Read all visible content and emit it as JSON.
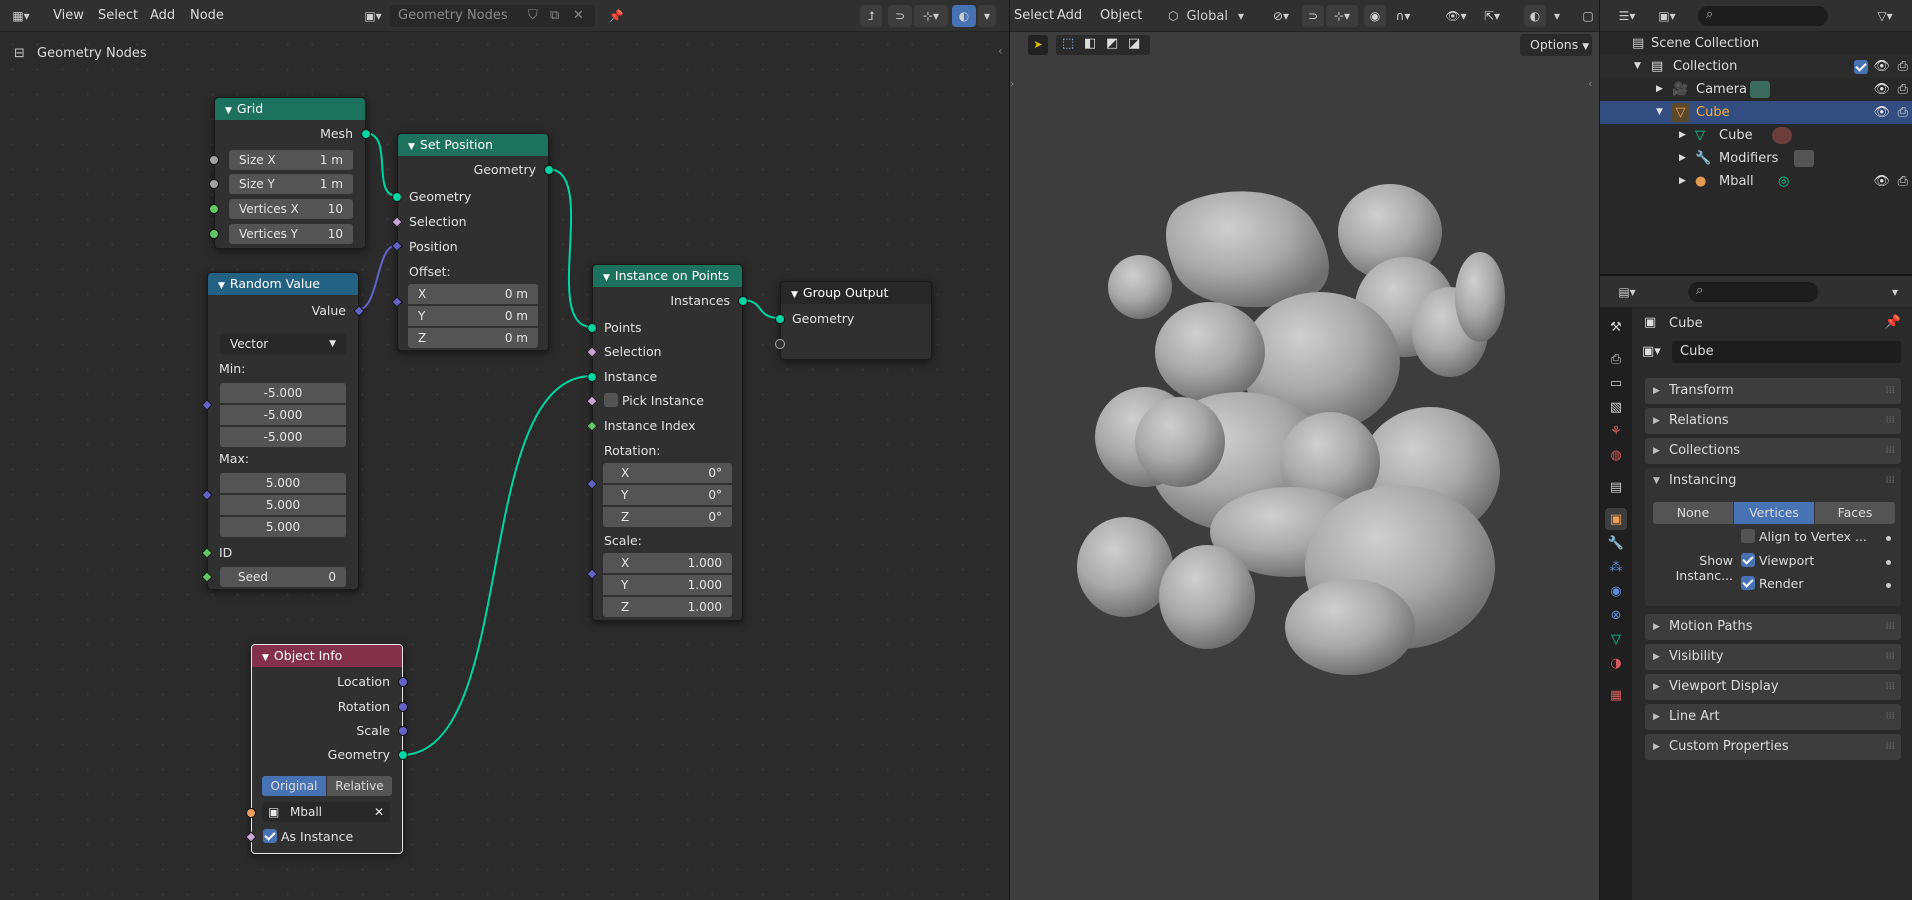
{
  "node_editor": {
    "menu": {
      "view": "View",
      "select": "Select",
      "add": "Add",
      "node": "Node"
    },
    "tree_name": "Geometry Nodes",
    "breadcrumb": "Geometry Nodes",
    "nodes": {
      "grid": {
        "title": "Grid",
        "out_mesh": "Mesh",
        "size_x_label": "Size X",
        "size_x": "1 m",
        "size_y_label": "Size Y",
        "size_y": "1 m",
        "vx_label": "Vertices X",
        "vx": "10",
        "vy_label": "Vertices Y",
        "vy": "10"
      },
      "set_position": {
        "title": "Set Position",
        "out_geometry": "Geometry",
        "in_geometry": "Geometry",
        "selection": "Selection",
        "position": "Position",
        "offset": "Offset:",
        "x_label": "X",
        "x": "0 m",
        "y_label": "Y",
        "y": "0 m",
        "z_label": "Z",
        "z": "0 m"
      },
      "random_value": {
        "title": "Random Value",
        "out_value": "Value",
        "type": "Vector",
        "min": "Min:",
        "min_vals": [
          "-5.000",
          "-5.000",
          "-5.000"
        ],
        "max": "Max:",
        "max_vals": [
          "5.000",
          "5.000",
          "5.000"
        ],
        "id": "ID",
        "seed_label": "Seed",
        "seed": "0"
      },
      "instance_on_points": {
        "title": "Instance on Points",
        "out_instances": "Instances",
        "points": "Points",
        "selection": "Selection",
        "instance": "Instance",
        "pick_instance": "Pick Instance",
        "instance_index": "Instance Index",
        "rotation": "Rotation:",
        "rx_label": "X",
        "rx": "0°",
        "ry_label": "Y",
        "ry": "0°",
        "rz_label": "Z",
        "rz": "0°",
        "scale": "Scale:",
        "sx_label": "X",
        "sx": "1.000",
        "sy_label": "Y",
        "sy": "1.000",
        "sz_label": "Z",
        "sz": "1.000"
      },
      "group_output": {
        "title": "Group Output",
        "geometry": "Geometry"
      },
      "object_info": {
        "title": "Object Info",
        "location": "Location",
        "rotation": "Rotation",
        "scale": "Scale",
        "geometry": "Geometry",
        "original": "Original",
        "relative": "Relative",
        "object": "Mball",
        "as_instance": "As Instance"
      }
    },
    "colors": {
      "geometry_socket": "#00d6a3",
      "vector_socket": "#6363c7",
      "header_geometry": "#1d725e",
      "header_input": "#83314a",
      "header_utility": "#246283",
      "header_output": "#272727"
    }
  },
  "viewport": {
    "menu": {
      "select": "Select",
      "add": "Add",
      "object": "Object"
    },
    "orientation": "Global",
    "options": "Options"
  },
  "outliner": {
    "scene_collection": "Scene Collection",
    "items": [
      {
        "label": "Collection"
      },
      {
        "label": "Camera"
      },
      {
        "label": "Cube"
      },
      {
        "label": "Cube"
      },
      {
        "label": "Modifiers"
      },
      {
        "label": "Mball"
      }
    ]
  },
  "properties": {
    "object_name": "Cube",
    "object_field": "Cube",
    "panels": {
      "transform": "Transform",
      "relations": "Relations",
      "collections": "Collections",
      "instancing": "Instancing",
      "motion_paths": "Motion Paths",
      "visibility": "Visibility",
      "viewport_display": "Viewport Display",
      "line_art": "Line Art",
      "custom_properties": "Custom Properties"
    },
    "instancing": {
      "none": "None",
      "vertices": "Vertices",
      "faces": "Faces",
      "align": "Align to Vertex ...",
      "show_label": "Show Instanc...",
      "viewport": "Viewport",
      "render": "Render"
    }
  }
}
